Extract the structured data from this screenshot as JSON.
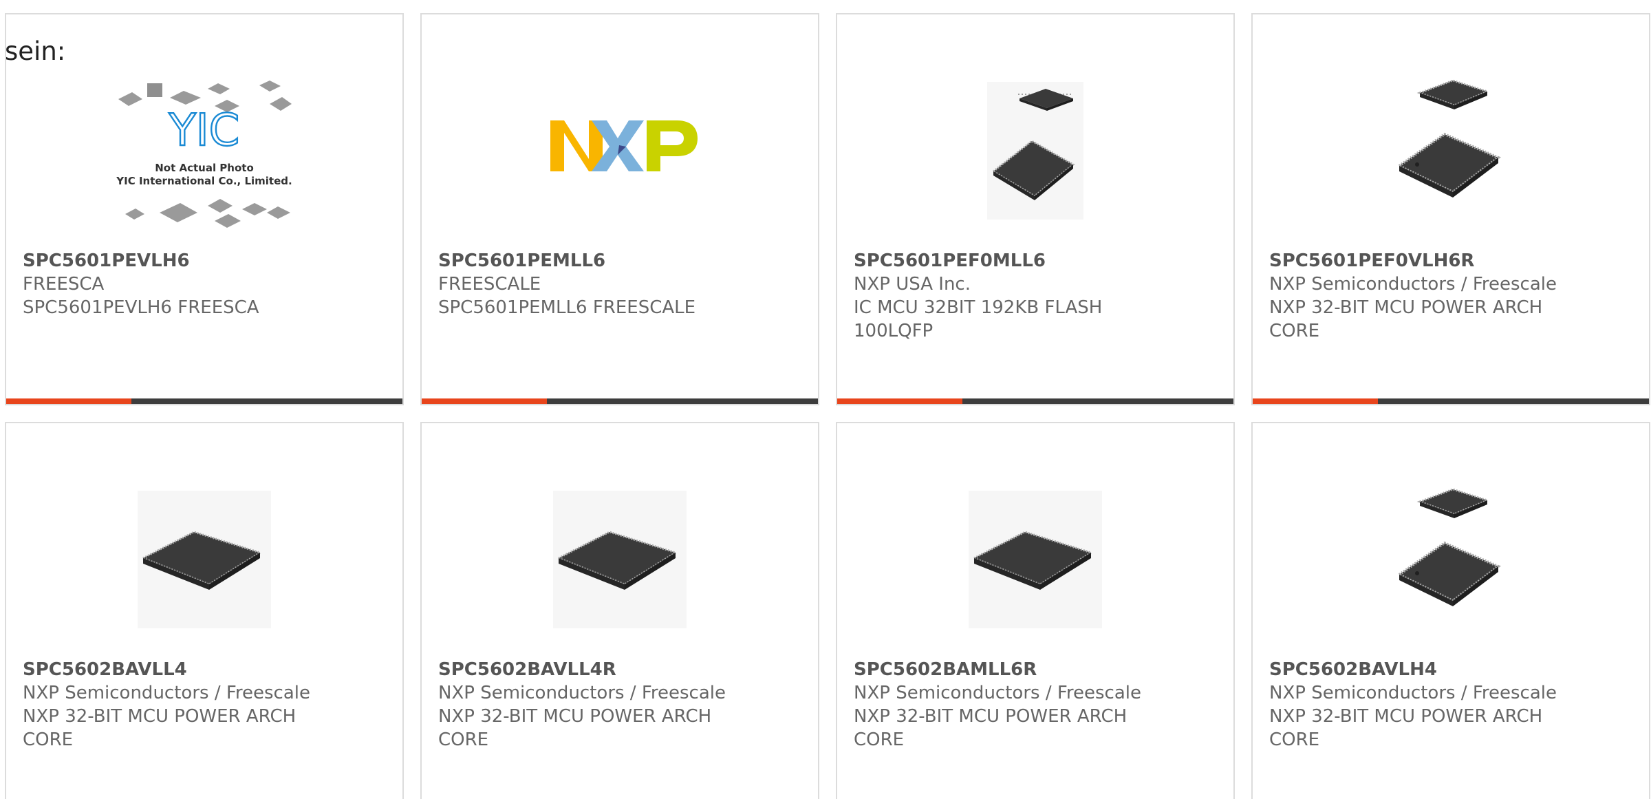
{
  "intro_text": "sein:",
  "colors": {
    "accent": "#e8451c",
    "bar_dark": "#3d3d3d",
    "border": "#dcdcdc",
    "chip": "#3a3a3a",
    "nxp_orange": "#f9b500",
    "nxp_blue": "#7bb1db",
    "nxp_green": "#c9d200",
    "yic_blue": "#1a8ad4"
  },
  "products": [
    {
      "part_number": "SPC5601PEVLH6",
      "manufacturer": "FREESCA",
      "description": "SPC5601PEVLH6 FREESCA",
      "image": "placeholder-not-actual-photo-image",
      "placeholder_note": "Not Actual Photo",
      "placeholder_company": "YIC International Co., Limited.",
      "placeholder_logo": "YIC"
    },
    {
      "part_number": "SPC5601PEMLL6",
      "manufacturer": "FREESCALE",
      "description": "SPC5601PEMLL6 FREESCALE",
      "image": "nxp-logo-image"
    },
    {
      "part_number": "SPC5601PEF0MLL6",
      "manufacturer": "NXP USA Inc.",
      "description": "IC MCU 32BIT 192KB FLASH 100LQFP",
      "image": "two-qfp-chips-image"
    },
    {
      "part_number": "SPC5601PEF0VLH6R",
      "manufacturer": "NXP Semiconductors / Freescale",
      "description": "NXP 32-BIT MCU POWER ARCH CORE",
      "image": "two-qfp-chips-image"
    },
    {
      "part_number": "SPC5602BAVLL4",
      "manufacturer": "NXP Semiconductors / Freescale",
      "description": "NXP 32-BIT MCU POWER ARCH CORE",
      "image": "lqfp-chip-image"
    },
    {
      "part_number": "SPC5602BAVLL4R",
      "manufacturer": "NXP Semiconductors / Freescale",
      "description": "NXP 32-BIT MCU POWER ARCH CORE",
      "image": "lqfp-chip-image"
    },
    {
      "part_number": "SPC5602BAMLL6R",
      "manufacturer": "NXP Semiconductors / Freescale",
      "description": "NXP 32-BIT MCU POWER ARCH CORE",
      "image": "lqfp-chip-image"
    },
    {
      "part_number": "SPC5602BAVLH4",
      "manufacturer": "NXP Semiconductors / Freescale",
      "description": "NXP 32-BIT MCU POWER ARCH CORE",
      "image": "two-qfp-chips-image"
    }
  ]
}
